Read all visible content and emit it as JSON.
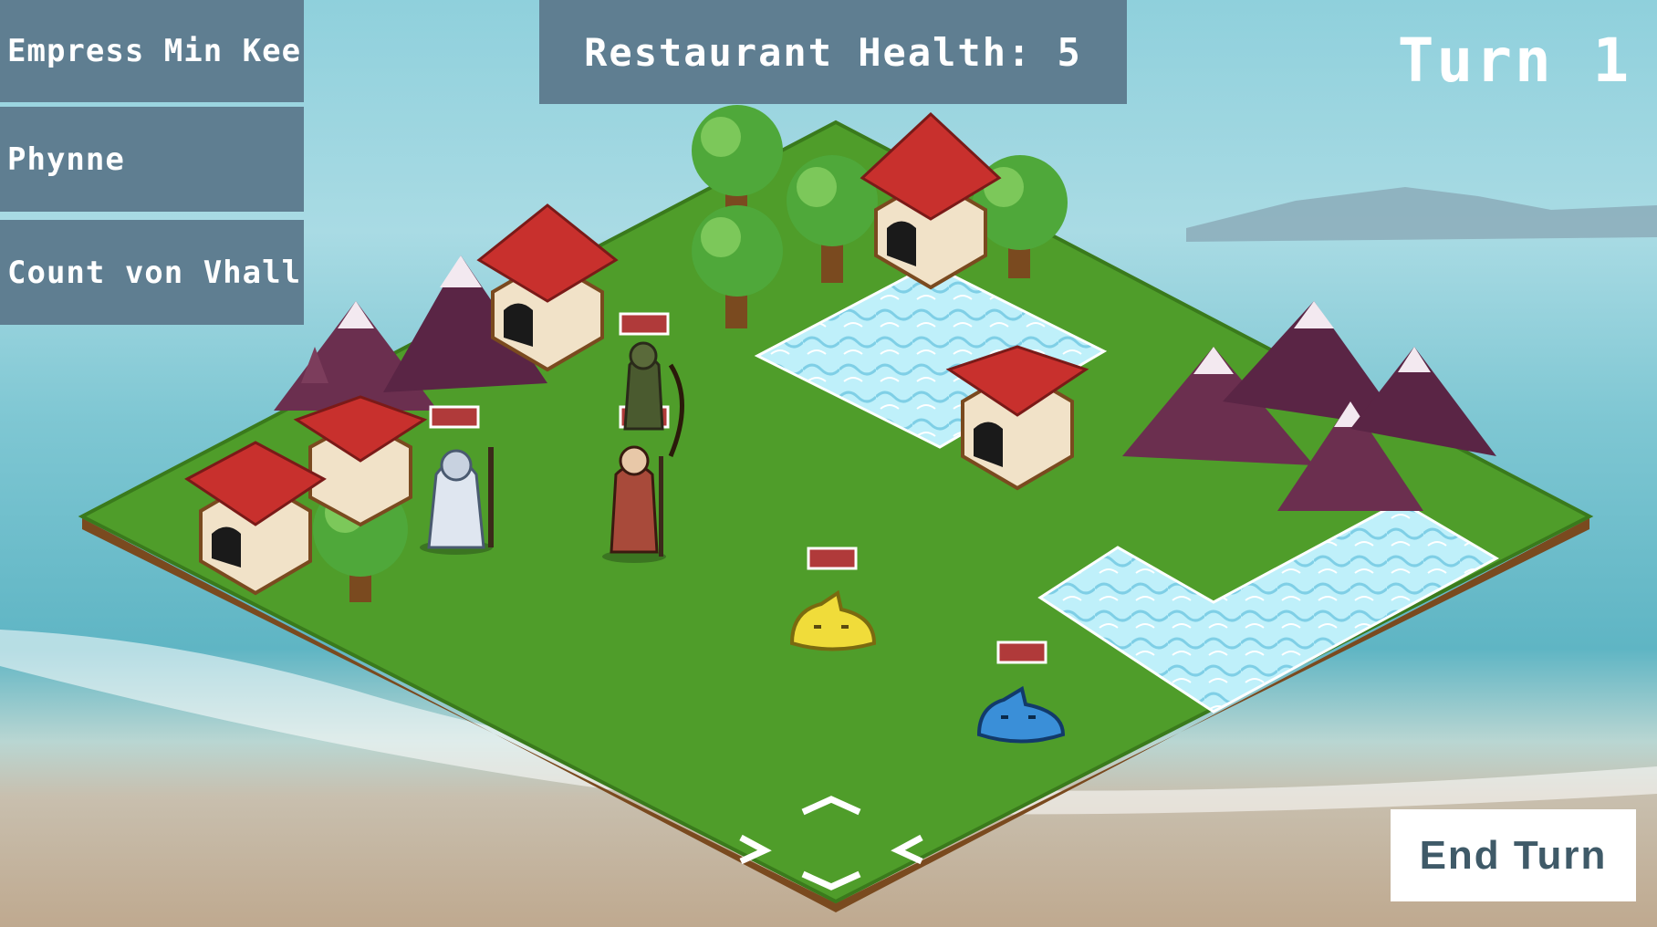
{
  "party": {
    "members": [
      {
        "name": "Empress Min Kee"
      },
      {
        "name": "Phynne"
      },
      {
        "name": "Count von Vhall"
      }
    ]
  },
  "hud": {
    "restaurant_health": "Restaurant Health: 5",
    "turn": "Turn 1",
    "end_turn_label": "End Turn"
  },
  "colors": {
    "panel": "#5f7e91",
    "panel_text": "#ffffff",
    "health_bar": "#b03a3a",
    "grass": "#4f9d2a",
    "water": "#b9ecf7",
    "roof": "#c8302d",
    "slime_yellow": "#f0dc3a",
    "slime_blue": "#3a8fd8"
  },
  "units": [
    {
      "kind": "knight-icon"
    },
    {
      "kind": "archer-icon"
    },
    {
      "kind": "warrior-icon"
    },
    {
      "kind": "yellow-slime-icon"
    },
    {
      "kind": "blue-slime-icon"
    }
  ]
}
